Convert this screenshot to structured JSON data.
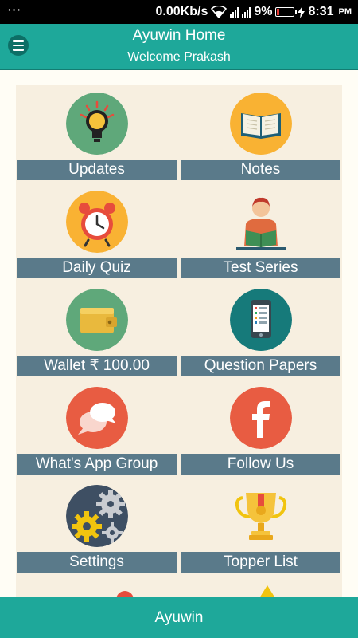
{
  "status_bar": {
    "dots": "···",
    "speed": "0.00Kb/s",
    "battery": "9%",
    "time": "8:31",
    "ampm": "PM"
  },
  "app_bar": {
    "title": "Ayuwin Home",
    "subtitle": "Welcome Prakash"
  },
  "tiles": [
    {
      "label": "Updates",
      "icon": "lightbulb-icon"
    },
    {
      "label": "Notes",
      "icon": "book-icon"
    },
    {
      "label": "Daily Quiz",
      "icon": "alarm-clock-icon"
    },
    {
      "label": "Test Series",
      "icon": "student-reading-icon"
    },
    {
      "label": "Wallet ₹ 100.00",
      "icon": "wallet-icon"
    },
    {
      "label": "Question Papers",
      "icon": "phone-document-icon"
    },
    {
      "label": "What's App Group",
      "icon": "chat-icon"
    },
    {
      "label": "Follow Us",
      "icon": "facebook-icon"
    },
    {
      "label": "Settings",
      "icon": "gears-icon"
    },
    {
      "label": "Topper List",
      "icon": "trophy-icon"
    }
  ],
  "bottom_bar": {
    "label": "Ayuwin"
  },
  "colors": {
    "primary": "#1ea89a",
    "tile_label_bg": "#5a7a8a",
    "grid_bg": "#f7efe0"
  }
}
